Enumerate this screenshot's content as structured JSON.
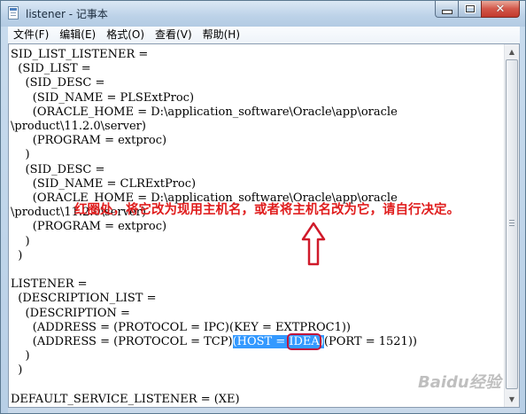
{
  "window": {
    "title": "listener - 记事本"
  },
  "menu": {
    "items": [
      "文件(F)",
      "编辑(E)",
      "格式(O)",
      "查看(V)",
      "帮助(H)"
    ]
  },
  "editor": {
    "lines_before": "SID_LIST_LISTENER =\n  (SID_LIST =\n    (SID_DESC =\n      (SID_NAME = PLSExtProc)\n      (ORACLE_HOME = D:\\application_software\\Oracle\\app\\oracle\n\\product\\11.2.0\\server)\n      (PROGRAM = extproc)\n    )\n    (SID_DESC =\n      (SID_NAME = CLRExtProc)\n      (ORACLE_HOME = D:\\application_software\\Oracle\\app\\oracle\n\\product\\11.2.0\\server)\n      (PROGRAM = extproc)\n    )\n  )\n\nLISTENER =\n  (DESCRIPTION_LIST =\n    (DESCRIPTION =\n      (ADDRESS = (PROTOCOL = IPC)(KEY = EXTPROC1))\n",
    "address_prefix": "      (ADDRESS = (PROTOCOL = TCP)",
    "selected_host_label": "(HOST = ",
    "selected_host_value": "IDEA",
    "selected_close": ")",
    "address_suffix": "(PORT = 1521))",
    "lines_after": "\n    )\n  )\n\nDEFAULT_SERVICE_LISTENER = (XE)"
  },
  "annotation": {
    "text": "红圈处，将它改为现用主机名，或者将主机名改为它，请自行决定。",
    "color": "#e01e1e"
  },
  "watermark": {
    "text": "Baidu经验"
  },
  "colors": {
    "selection": "#3399ff",
    "circle": "#c0143c"
  }
}
